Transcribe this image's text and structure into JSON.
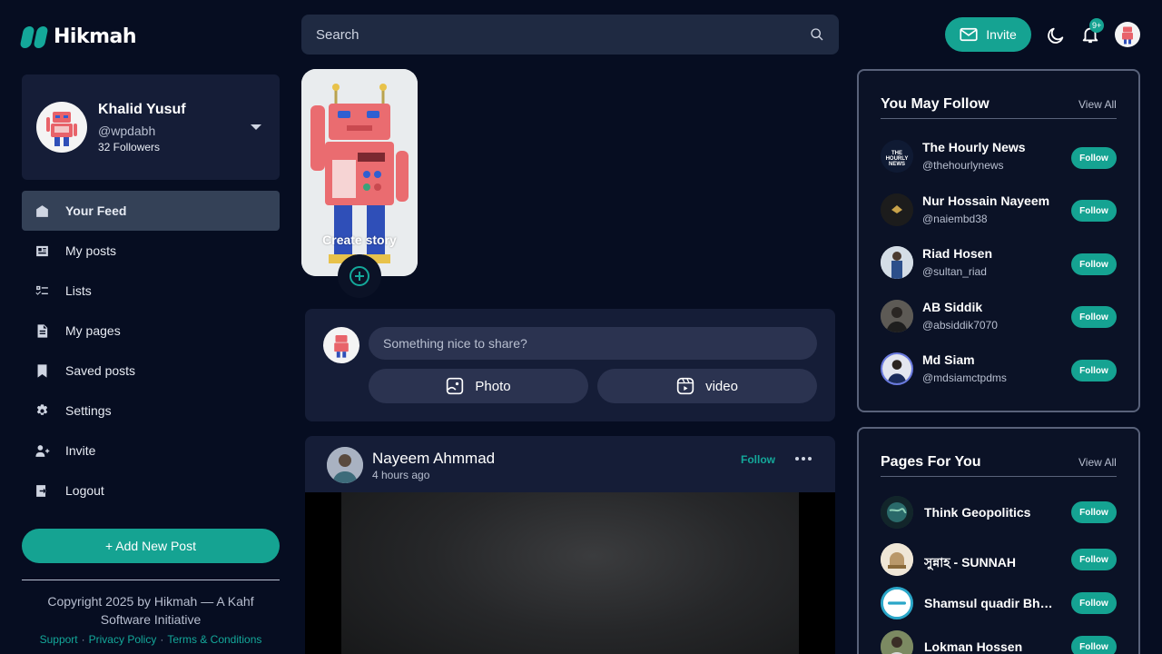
{
  "brand": {
    "name": "Hikmah",
    "accent": "#15a392"
  },
  "profile": {
    "name": "Khalid Yusuf",
    "handle": "@wpdabh",
    "followers": "32 Followers"
  },
  "nav": [
    {
      "label": "Your Feed",
      "icon": "home-icon",
      "active": true
    },
    {
      "label": "My posts",
      "icon": "newspaper-icon"
    },
    {
      "label": "Lists",
      "icon": "checklist-icon"
    },
    {
      "label": "My pages",
      "icon": "document-icon"
    },
    {
      "label": "Saved posts",
      "icon": "bookmark-icon"
    },
    {
      "label": "Settings",
      "icon": "gear-icon"
    },
    {
      "label": "Invite",
      "icon": "user-plus-icon"
    },
    {
      "label": "Logout",
      "icon": "logout-icon"
    }
  ],
  "sidebar": {
    "add_post": "+ Add New Post",
    "copyright": "Copyright 2025 by Hikmah — A Kahf Software Initiative",
    "links": [
      "Support",
      "Privacy Policy",
      "Terms & Conditions"
    ]
  },
  "topbar": {
    "search_placeholder": "Search",
    "invite_label": "Invite",
    "notification_badge": "9+"
  },
  "story": {
    "label": "Create story"
  },
  "composer": {
    "placeholder": "Something nice to share?",
    "photo_label": "Photo",
    "video_label": "video"
  },
  "post": {
    "author": "Nayeem Ahmmad",
    "time": "4 hours ago",
    "follow_label": "Follow"
  },
  "you_may_follow": {
    "title": "You May Follow",
    "view_all": "View All",
    "items": [
      {
        "name": "The Hourly News",
        "handle": "@thehourlynews",
        "follow": "Follow"
      },
      {
        "name": "Nur Hossain Nayeem",
        "handle": "@naiembd38",
        "follow": "Follow"
      },
      {
        "name": "Riad Hosen",
        "handle": "@sultan_riad",
        "follow": "Follow"
      },
      {
        "name": "AB Siddik",
        "handle": "@absiddik7070",
        "follow": "Follow"
      },
      {
        "name": "Md Siam",
        "handle": "@mdsiamctpdms",
        "follow": "Follow"
      }
    ]
  },
  "pages_for_you": {
    "title": "Pages For You",
    "view_all": "View All",
    "items": [
      {
        "name": "Think Geopolitics",
        "follow": "Follow"
      },
      {
        "name": "সুন্নাহ - SUNNAH",
        "follow": "Follow"
      },
      {
        "name": "Shamsul quadir Bhuiyan",
        "follow": "Follow"
      },
      {
        "name": "Lokman Hossen",
        "follow": "Follow"
      }
    ]
  }
}
